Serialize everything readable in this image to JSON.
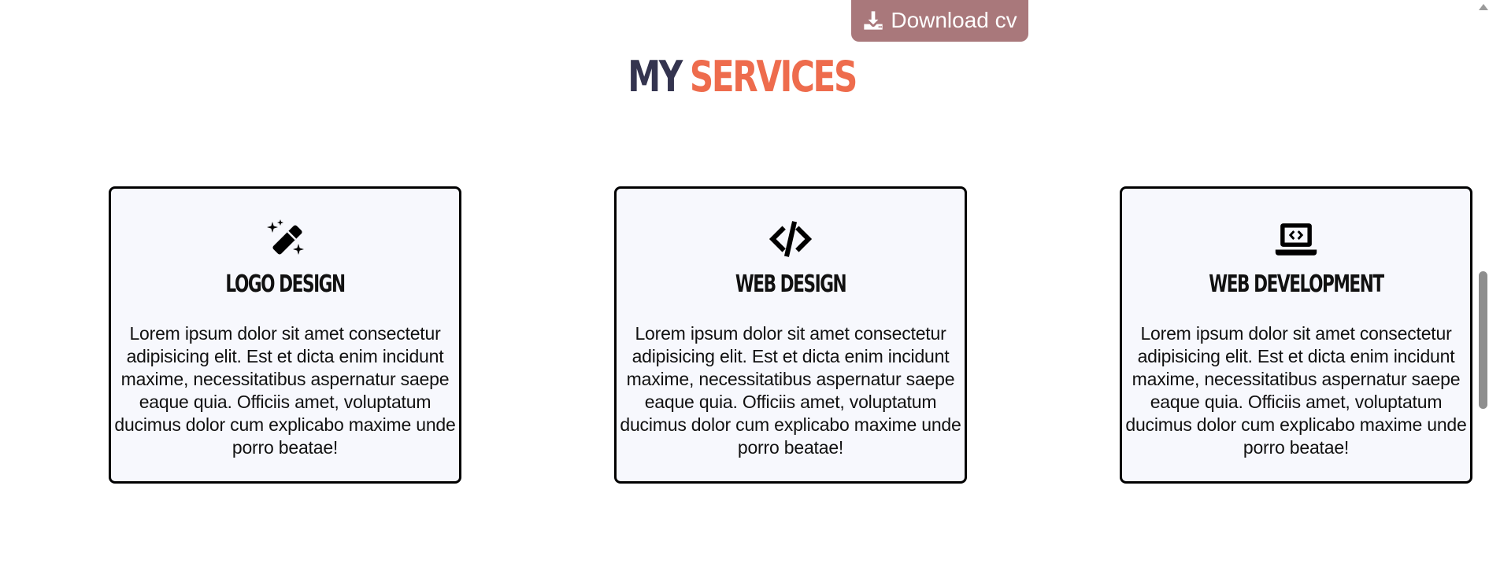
{
  "download_button": {
    "label": "Download cv",
    "icon": "download-icon"
  },
  "section": {
    "title_part_1": "MY",
    "title_part_2": "SERVICES",
    "colors": {
      "dark": "#34344f",
      "accent": "#ee6c4d",
      "button": "#a9787b"
    }
  },
  "services": [
    {
      "icon": "magic-wand-icon",
      "title": "LOGO DESIGN",
      "text": "Lorem ipsum dolor sit amet consectetur adipisicing elit. Est et dicta enim incidunt maxime, necessitatibus aspernatur saepe eaque quia. Officiis amet, voluptatum ducimus dolor cum explicabo maxime unde porro beatae!"
    },
    {
      "icon": "code-icon",
      "title": "WEB DESIGN",
      "text": "Lorem ipsum dolor sit amet consectetur adipisicing elit. Est et dicta enim incidunt maxime, necessitatibus aspernatur saepe eaque quia. Officiis amet, voluptatum ducimus dolor cum explicabo maxime unde porro beatae!"
    },
    {
      "icon": "laptop-code-icon",
      "title": "WEB DEVELOPMENT",
      "text": "Lorem ipsum dolor sit amet consectetur adipisicing elit. Est et dicta enim incidunt maxime, necessitatibus aspernatur saepe eaque quia. Officiis amet, voluptatum ducimus dolor cum explicabo maxime unde porro beatae!"
    }
  ]
}
